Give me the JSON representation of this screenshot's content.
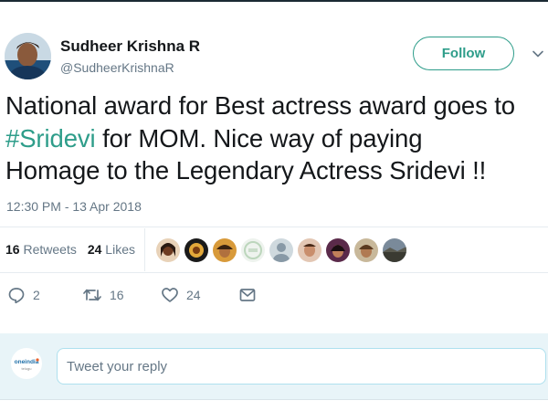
{
  "author": {
    "name": "Sudheer Krishna R",
    "handle": "@SudheerKrishnaR"
  },
  "follow_label": "Follow",
  "tweet": {
    "line1": "National award for Best actress award goes to",
    "hashtag": "#Sridevi",
    "line2_rest": " for MOM. Nice way of paying",
    "line3": "Homage to the Legendary Actress Sridevi !!",
    "timestamp": "12:30 PM - 13 Apr 2018"
  },
  "stats": {
    "retweets_count": "16",
    "retweets_label": "Retweets",
    "likes_count": "24",
    "likes_label": "Likes"
  },
  "actions": {
    "reply_count": "2",
    "retweet_count": "16",
    "like_count": "24"
  },
  "reply": {
    "placeholder": "Tweet your reply",
    "logo_text": "oneindia",
    "logo_subtext": "telugu"
  },
  "colors": {
    "accent": "#2e9d8a",
    "secondary_text": "#657786",
    "reply_background": "#e8f4f8"
  },
  "icons": [
    "chevron-down-icon",
    "reply-icon",
    "retweet-icon",
    "heart-icon",
    "direct-message-icon"
  ]
}
